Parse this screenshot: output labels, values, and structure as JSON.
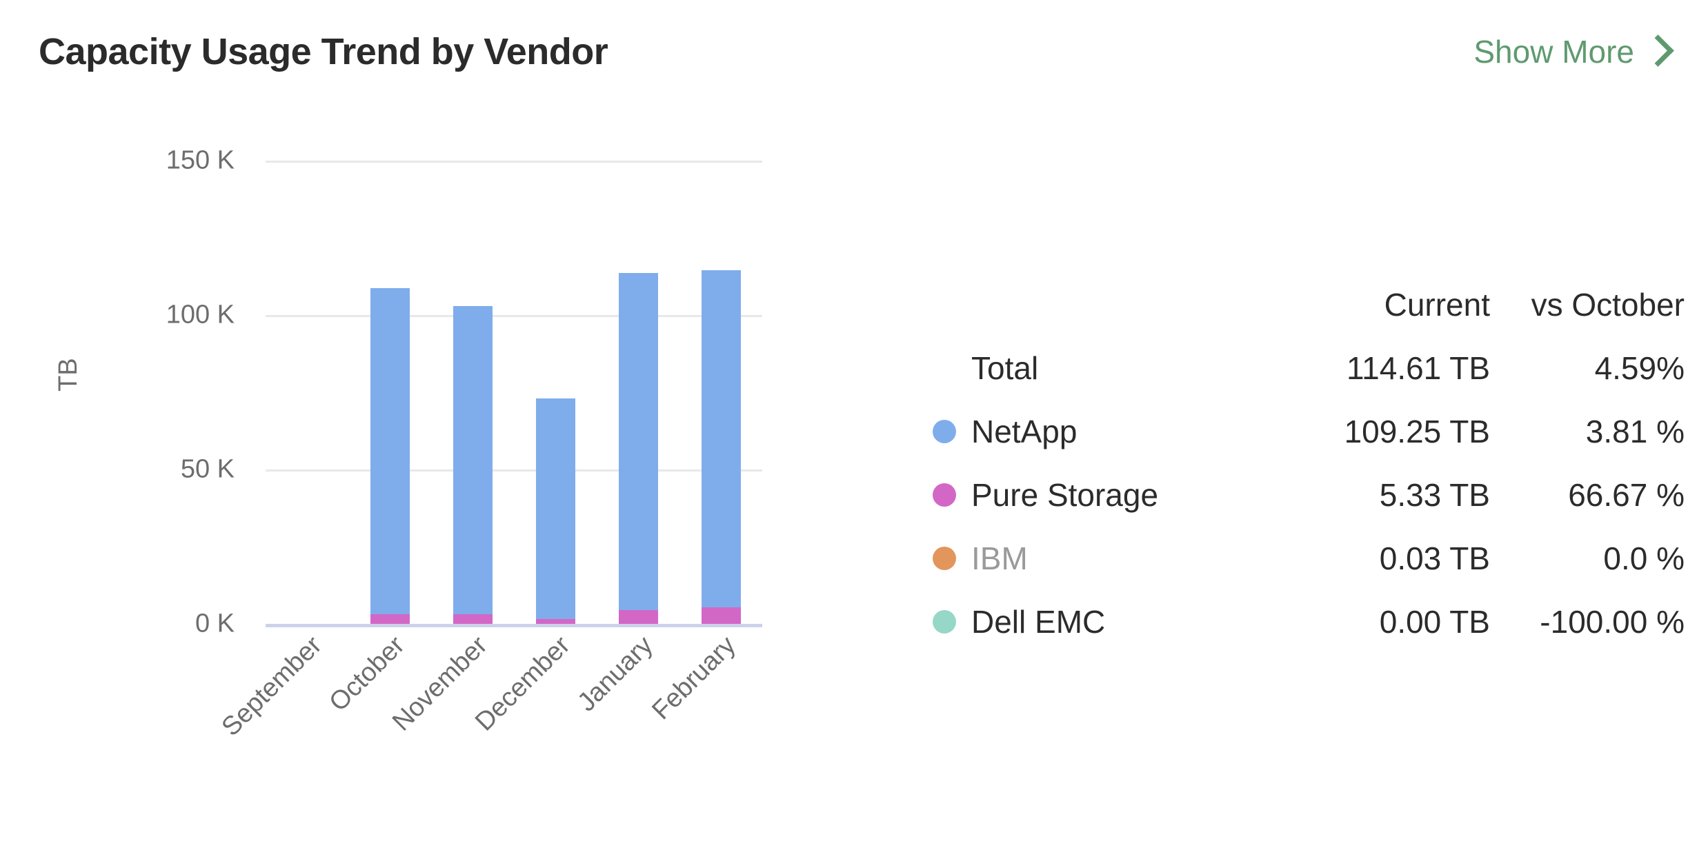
{
  "header": {
    "title": "Capacity Usage Trend by Vendor",
    "show_more_label": "Show More",
    "show_more_color": "#5f9a6f"
  },
  "table": {
    "col_name_header": "",
    "col_current_header": "Current",
    "col_delta_header": "vs October",
    "rows": [
      {
        "name": "Total",
        "current": "114.61 TB",
        "delta": "4.59%",
        "color": "",
        "muted": false
      },
      {
        "name": "NetApp",
        "current": "109.25 TB",
        "delta": "3.81 %",
        "color": "#7fadec",
        "muted": false
      },
      {
        "name": "Pure Storage",
        "current": "5.33 TB",
        "delta": "66.67 %",
        "color": "#d367c6",
        "muted": false
      },
      {
        "name": "IBM",
        "current": "0.03 TB",
        "delta": "0.0 %",
        "color": "#e3965c",
        "muted": true
      },
      {
        "name": "Dell EMC",
        "current": "0.00 TB",
        "delta": "-100.00 %",
        "color": "#97d7c7",
        "muted": false
      }
    ]
  },
  "chart_data": {
    "type": "bar",
    "stacked": true,
    "title": "Capacity Usage Trend by Vendor",
    "xlabel": "",
    "ylabel": "TB",
    "ylim": [
      0,
      150000
    ],
    "ytick_labels": [
      "150 K",
      "100 K",
      "50 K",
      "0 K"
    ],
    "ytick_values": [
      150000,
      100000,
      50000,
      0
    ],
    "grid": true,
    "legend_position": "right-table",
    "categories": [
      "September",
      "October",
      "November",
      "December",
      "January",
      "February"
    ],
    "series": [
      {
        "name": "NetApp",
        "color": "#7fadec",
        "values": [
          0,
          105500,
          99700,
          71400,
          109000,
          109250
        ]
      },
      {
        "name": "Pure Storage",
        "color": "#d367c6",
        "values": [
          0,
          3100,
          3100,
          1600,
          4500,
          5330
        ]
      },
      {
        "name": "IBM",
        "color": "#e3965c",
        "values": [
          0,
          30,
          30,
          30,
          30,
          30
        ]
      },
      {
        "name": "Dell EMC",
        "color": "#97d7c7",
        "values": [
          0,
          0,
          0,
          0,
          0,
          0
        ]
      }
    ],
    "totals": [
      0,
      108600,
      102800,
      73000,
      113500,
      114610
    ]
  },
  "colors": {
    "gridline": "#e8e8e8",
    "baseline": "#ccd2ea",
    "axis_text": "#6d6d6d"
  }
}
